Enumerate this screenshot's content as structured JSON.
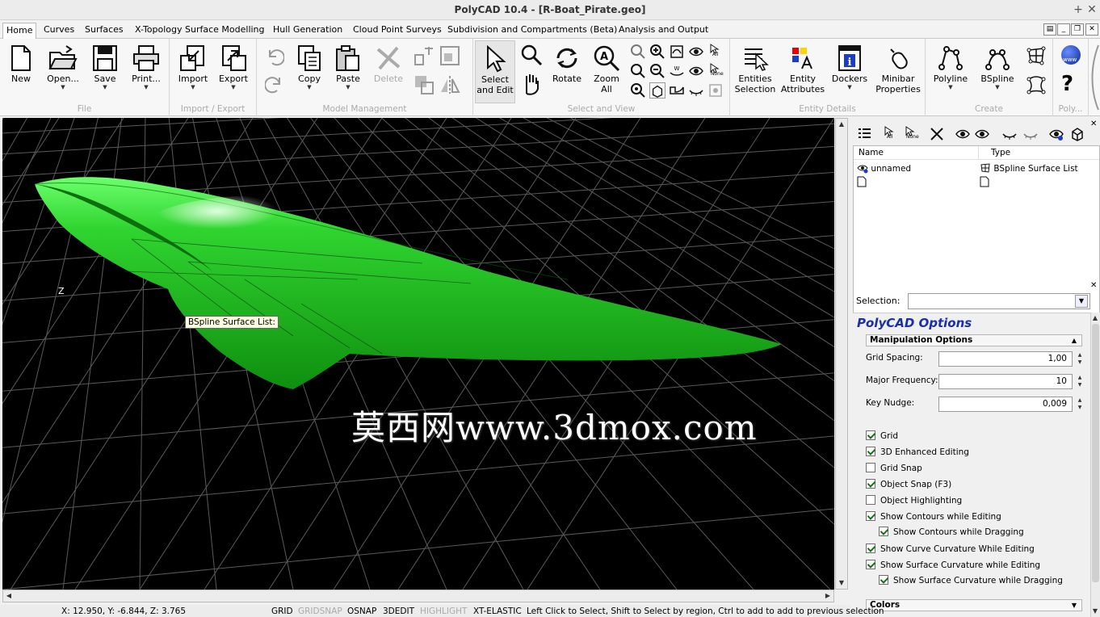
{
  "window": {
    "title": "PolyCAD 10.4 - [R-Boat_Pirate.geo]"
  },
  "tabs": [
    {
      "label": "Home",
      "active": true
    },
    {
      "label": "Curves"
    },
    {
      "label": "Surfaces"
    },
    {
      "label": "X-Topology Surface Modelling"
    },
    {
      "label": "Hull Generation"
    },
    {
      "label": "Cloud Point Surveys"
    },
    {
      "label": "Subdivision and Compartments (Beta)"
    },
    {
      "label": "Analysis and Output"
    }
  ],
  "ribbon": {
    "file": {
      "label": "File",
      "new": "New",
      "open": "Open...",
      "save": "Save",
      "print": "Print..."
    },
    "import_export": {
      "label": "Import / Export",
      "import": "Import",
      "export": "Export"
    },
    "model": {
      "label": "Model Management",
      "copy": "Copy",
      "paste": "Paste",
      "delete": "Delete"
    },
    "select_view": {
      "label": "Select and View",
      "select_line1": "Select",
      "select_line2": "and Edit",
      "rotate": "Rotate",
      "zoom_line1": "Zoom",
      "zoom_line2": "All"
    },
    "entity": {
      "label": "Entity Details",
      "sel_line1": "Entities",
      "sel_line2": "Selection",
      "attr_line1": "Entity",
      "attr_line2": "Attributes",
      "dockers": "Dockers",
      "minibar_line1": "Minibar",
      "minibar_line2": "Properties"
    },
    "create": {
      "label": "Create",
      "polyline": "Polyline",
      "bspline": "BSpline"
    },
    "poly": {
      "label": "Poly..."
    }
  },
  "icons": {
    "all": "All",
    "none": "None",
    "www": "www"
  },
  "viewport": {
    "axis_label": "Z",
    "tooltip": "BSpline Surface List:",
    "watermark": "莫西网www.3dmox.com",
    "hull_color": "#1fb81f"
  },
  "entity_list": {
    "columns": [
      "Name",
      "Type"
    ],
    "rows": [
      {
        "name": "unnamed",
        "type": "BSpline Surface List"
      }
    ]
  },
  "selection": {
    "label": "Selection:",
    "value": ""
  },
  "options": {
    "title": "PolyCAD Options",
    "section": "Manipulation Options",
    "fields": [
      {
        "label": "Grid Spacing:",
        "value": "1,00"
      },
      {
        "label": "Major Frequency:",
        "value": "10"
      },
      {
        "label": "Key Nudge:",
        "value": "0,009"
      }
    ],
    "checks": [
      {
        "label": "Grid",
        "checked": true,
        "indent": 0
      },
      {
        "label": "3D Enhanced Editing",
        "checked": true,
        "indent": 0
      },
      {
        "label": "Grid Snap",
        "checked": false,
        "indent": 0
      },
      {
        "label": "Object Snap (F3)",
        "checked": true,
        "indent": 0
      },
      {
        "label": "Object Highlighting",
        "checked": false,
        "indent": 0
      },
      {
        "label": "Show Contours while Editing",
        "checked": true,
        "indent": 0
      },
      {
        "label": "Show Contours while Dragging",
        "checked": true,
        "indent": 1
      },
      {
        "label": "Show Curve Curvature While Editing",
        "checked": true,
        "indent": 0
      },
      {
        "label": "Show Surface Curvature while Editing",
        "checked": true,
        "indent": 0
      },
      {
        "label": "Show Surface Curvature while Dragging",
        "checked": true,
        "indent": 1
      }
    ],
    "colors_section": "Colors"
  },
  "status": {
    "coords": "X:  12.950, Y:  -6.844, Z:   3.765",
    "grid": "GRID",
    "gridsnap": "GRIDSNAP",
    "osnap": "OSNAP",
    "edit3d": "3DEDIT",
    "highlight": "HIGHLIGHT",
    "xtelastic": "XT-ELASTIC",
    "message": "Left Click to Select, Shift to Select by region, Ctrl to add to add to previous selection"
  }
}
